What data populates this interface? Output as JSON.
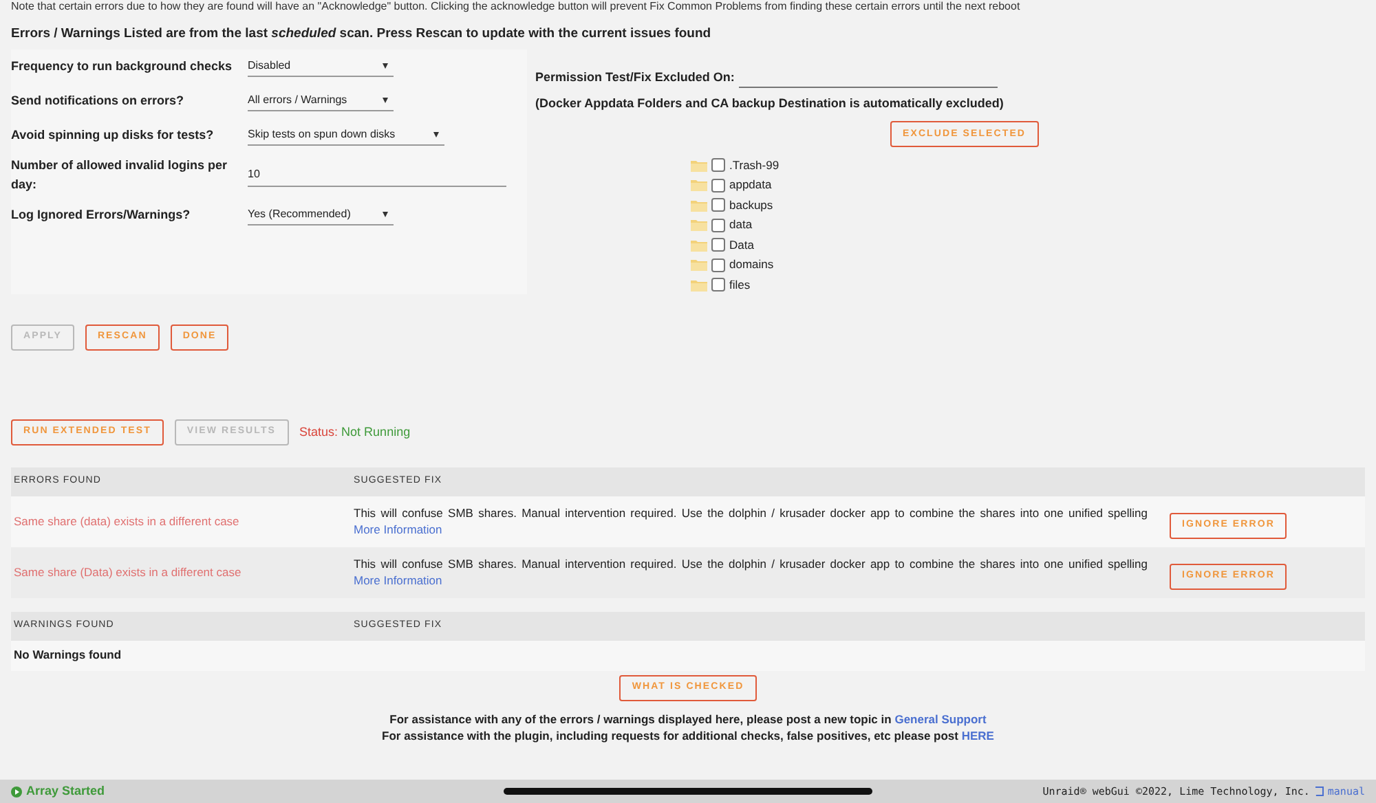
{
  "note": "Note that certain errors due to how they are found will have an \"Acknowledge\" button. Clicking the acknowledge button will prevent Fix Common Problems from finding these certain errors until the next reboot",
  "heading": "Errors / Warnings Listed are from the last *scheduled* scan. Press Rescan to update with the current issues found",
  "settings": [
    {
      "label": "Frequency to run background checks",
      "kind": "select",
      "value": "Disabled"
    },
    {
      "label": "Send notifications on errors?",
      "kind": "select",
      "value": "All errors / Warnings"
    },
    {
      "label": "Avoid spinning up disks for tests?",
      "kind": "select",
      "value": "Skip tests on spun down disks"
    },
    {
      "label": "Number of allowed invalid logins per day:",
      "kind": "input",
      "value": "10"
    },
    {
      "label": "Log Ignored Errors/Warnings?",
      "kind": "select",
      "value": "Yes (Recommended)"
    }
  ],
  "exclusions": {
    "title": "Permission Test/Fix Excluded On:",
    "note": "(Docker Appdata Folders and CA backup Destination is automatically excluded)",
    "button": "EXCLUDE SELECTED",
    "folders": [
      {
        "name": ".Trash-99",
        "checked": false
      },
      {
        "name": "appdata",
        "checked": false
      },
      {
        "name": "backups",
        "checked": false
      },
      {
        "name": "data",
        "checked": false
      },
      {
        "name": "Data",
        "checked": false
      },
      {
        "name": "domains",
        "checked": false
      },
      {
        "name": "files",
        "checked": false
      }
    ]
  },
  "buttons": [
    {
      "label": "APPLY",
      "disabled": true
    },
    {
      "label": "RESCAN",
      "disabled": false
    },
    {
      "label": "DONE",
      "disabled": false
    }
  ],
  "extended_buttons": [
    {
      "label": "RUN EXTENDED TEST",
      "disabled": false
    },
    {
      "label": "VIEW RESULTS",
      "disabled": true
    }
  ],
  "status": {
    "label": "Status:",
    "value": "Not Running"
  },
  "errors": {
    "columns": [
      "ERRORS FOUND",
      "SUGGESTED FIX"
    ],
    "rows": [
      {
        "error": "Same share (data) exists in a different case",
        "fix": "This will confuse SMB shares. Manual intervention required. Use the dolphin / krusader docker app to combine the shares into one unified spelling",
        "link": "More Information",
        "action": "IGNORE ERROR"
      },
      {
        "error": "Same share (Data) exists in a different case",
        "fix": "This will confuse SMB shares. Manual intervention required. Use the dolphin / krusader docker app to combine the shares into one unified spelling",
        "link": "More Information",
        "action": "IGNORE ERROR"
      }
    ]
  },
  "warnings": {
    "columns": [
      "WARNINGS FOUND",
      "SUGGESTED FIX"
    ],
    "empty": "No Warnings found"
  },
  "what_is_checked": "WHAT IS CHECKED",
  "assistance": [
    {
      "text": "For assistance with any of the errors / warnings displayed here, please post a new topic in",
      "link": "General Support"
    },
    {
      "text": "For assistance with the plugin, including requests for additional checks, false positives, etc please post",
      "link": "HERE"
    }
  ],
  "footer": {
    "status": "Array Started",
    "copyright": "Unraid® webGui ©2022, Lime Technology, Inc.",
    "manual": "manual"
  }
}
